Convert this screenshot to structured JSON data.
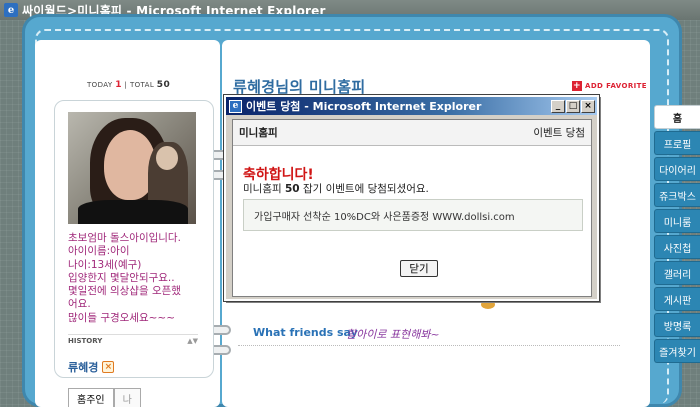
{
  "window": {
    "title": "싸이월드>미니홈피 - Microsoft Internet Explorer"
  },
  "left_page": {
    "counter": {
      "today_label": "TODAY",
      "today_value": "1",
      "separator": "|",
      "total_label": "TOTAL",
      "total_value": "50"
    },
    "intro_lines": [
      "초보엄마 돌스아이입니다.",
      "아이이름:아이",
      "나이:13세(예구)",
      "입양한지 몇달안되구요..",
      "몇일전에 의상샵을 오픈했",
      "어요.",
      "많이들 구경오세요~~~"
    ],
    "history_label": "HISTORY",
    "history_arrows": "▲▼",
    "owner_name": "류혜경",
    "owner_badge": "×",
    "tabs": [
      "홈주인",
      "나"
    ]
  },
  "right_page": {
    "title": "류혜경님의 미니홈피",
    "add_favorite": "ADD FAVORITE",
    "add_favorite_icon": "+",
    "friends_label": "What friends say",
    "friends_message": "할아이로 표현해봐~"
  },
  "side_tabs": [
    "홈",
    "프로필",
    "다이어리",
    "쥬크박스",
    "미니룸",
    "사진첩",
    "갤러리",
    "게시판",
    "방명록",
    "즐겨찾기"
  ],
  "popup": {
    "title": "이벤트 당첨 - Microsoft Internet Explorer",
    "win_buttons": [
      "_",
      "□",
      "×"
    ],
    "header_left": "미니홈피",
    "header_right": "이벤트 당첨",
    "congrats": "축하합니다!",
    "desc_prefix": "미니홈피",
    "desc_number": "50",
    "desc_suffix": "잡기 이벤트에 당첨되셨어요.",
    "info": "가입구매자 선착순 10%DC와 사은품증정 WWW.dollsi.com",
    "close_label": "닫기"
  },
  "colors": {
    "book_blue": "#56a8cf",
    "title_blue": "#2f6ca1",
    "accent_red": "#d23",
    "intro_purple": "#a0287a"
  }
}
